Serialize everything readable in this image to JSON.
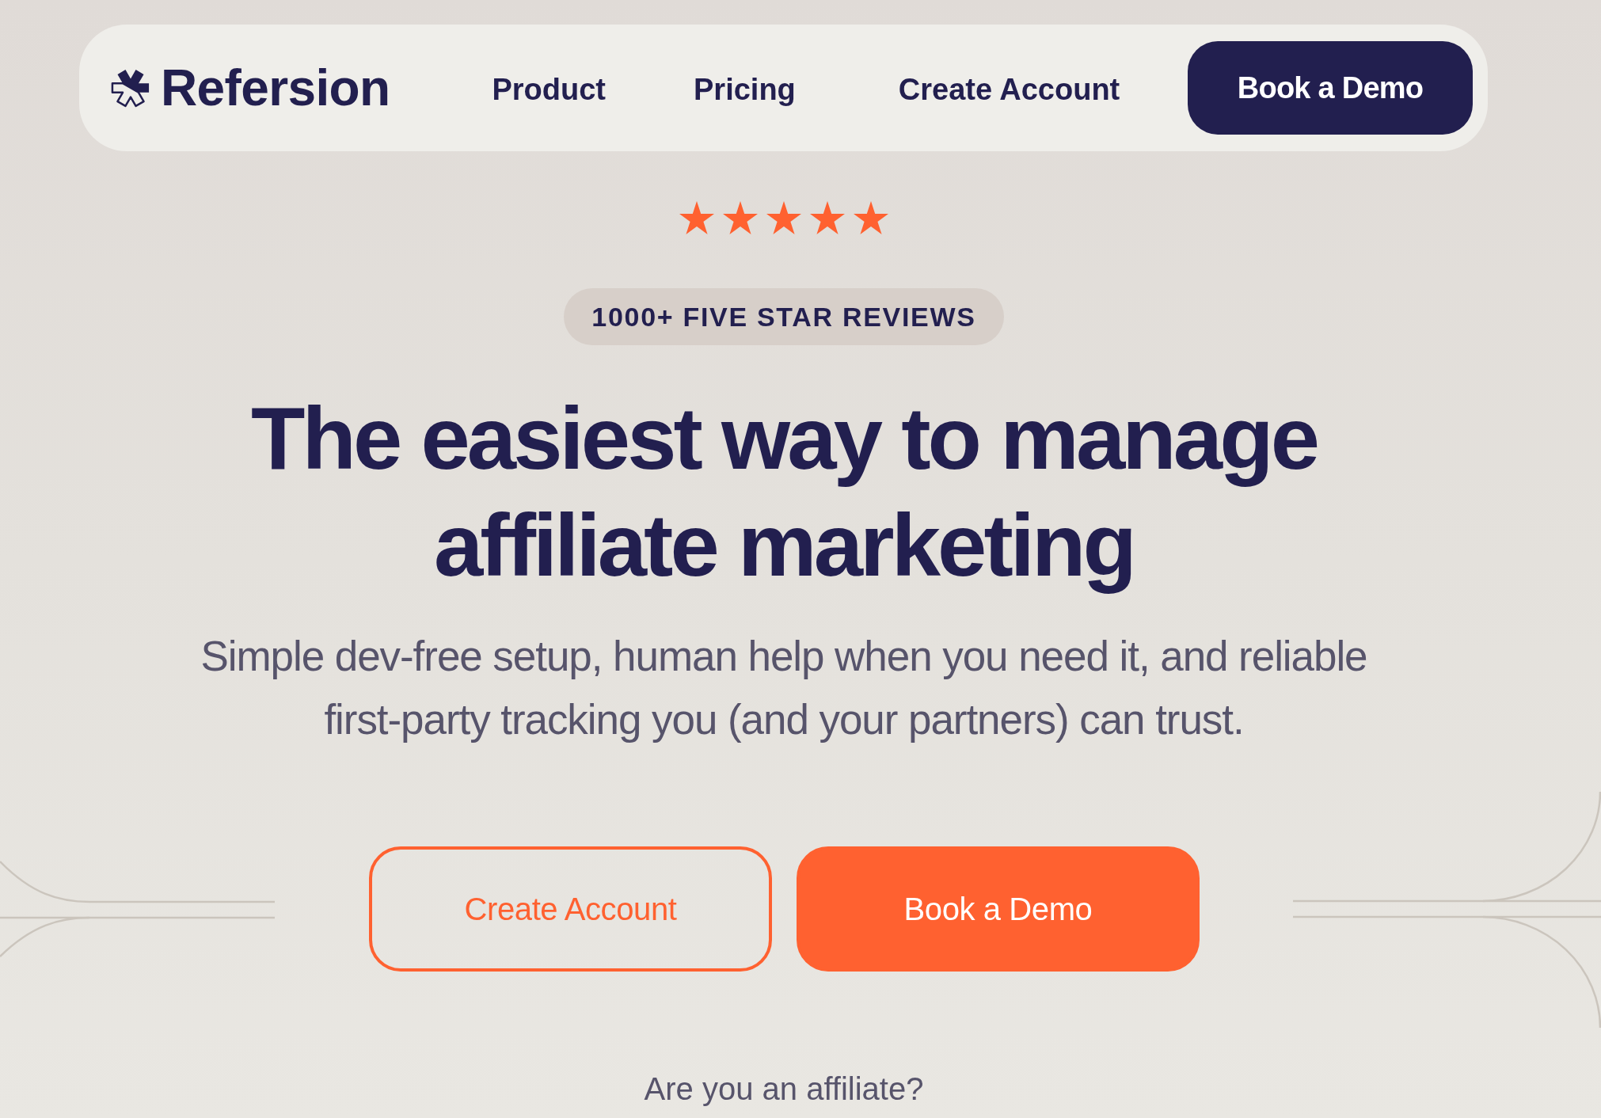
{
  "nav": {
    "logo": "Refersion",
    "links": [
      "Product",
      "Pricing",
      "Create Account"
    ],
    "cta": "Book a Demo"
  },
  "rating": {
    "stars": 5
  },
  "badge": "1000+ FIVE STAR REVIEWS",
  "headline": [
    "The easiest way to manage",
    "affiliate marketing"
  ],
  "subtitle": [
    "Simple dev-free setup, human help when you need it, and reliable",
    "first-party tracking you (and your partners) can trust."
  ],
  "buttons": [
    {
      "label": "Create Account",
      "kind": "outline"
    },
    {
      "label": "Book a Demo",
      "kind": "filled"
    }
  ],
  "affiliate_link": "Are you an affiliate?"
}
